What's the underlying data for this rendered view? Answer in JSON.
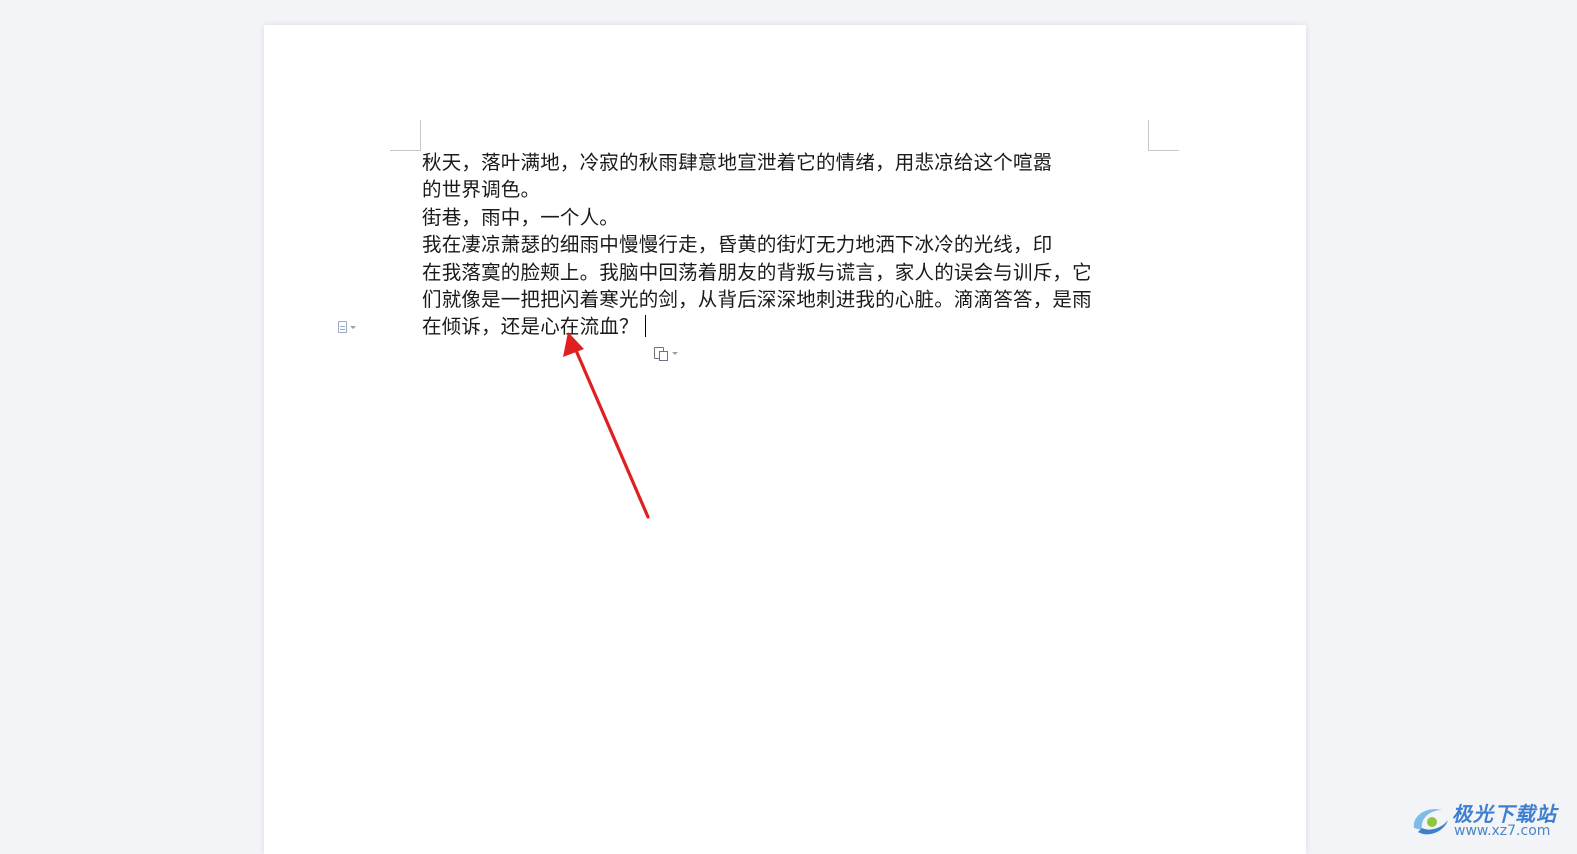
{
  "document": {
    "lines": [
      "秋天，落叶满地，冷寂的秋雨肆意地宣泄着它的情绪，用悲凉给这个喧嚣",
      "的世界调色。",
      "街巷，雨中，一个人。",
      "我在凄凉萧瑟的细雨中慢慢行走，昏黄的街灯无力地洒下冰冷的光线，印",
      "在我落寞的脸颊上。我脑中回荡着朋友的背叛与谎言，家人的误会与训斥，它",
      "们就像是一把把闪着寒光的剑，从背后深深地刺进我的心脏。滴滴答答，是雨",
      "在倾诉，还是心在流血？"
    ]
  },
  "icons": {
    "paragraph_handle": "document-paragraph-icon",
    "paste_options": "paste-options-icon",
    "annotation": "red-arrow"
  },
  "watermark": {
    "title": "极光下载站",
    "url": "www.xz7.com"
  },
  "colors": {
    "background": "#f3f4f7",
    "page": "#ffffff",
    "text": "#1a1a1a",
    "arrow": "#e02020",
    "watermark": "#3f7fcf"
  }
}
